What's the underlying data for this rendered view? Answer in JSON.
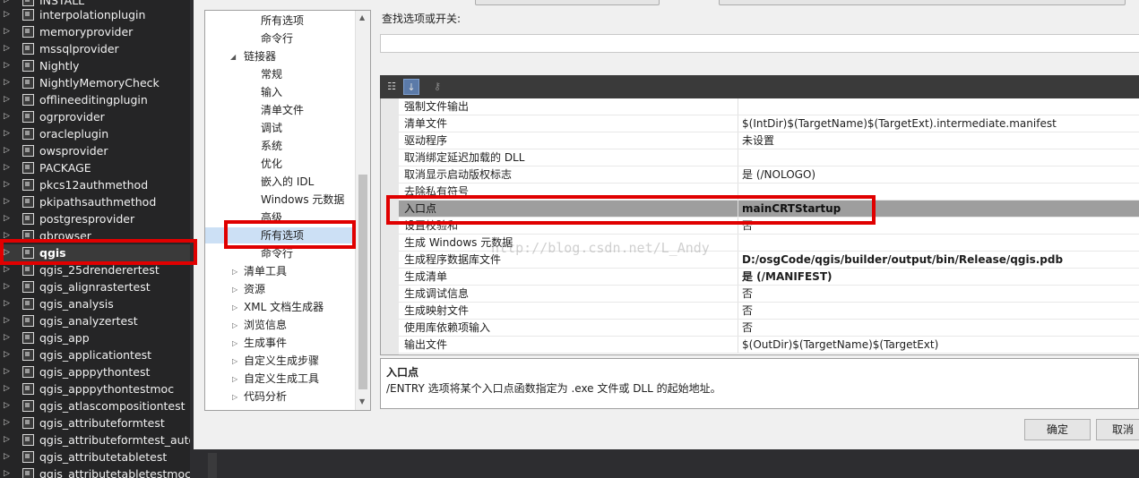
{
  "solution": {
    "projects": [
      {
        "label": "INSTALL"
      },
      {
        "label": "interpolationplugin"
      },
      {
        "label": "memoryprovider"
      },
      {
        "label": "mssqlprovider"
      },
      {
        "label": "Nightly"
      },
      {
        "label": "NightlyMemoryCheck"
      },
      {
        "label": "offlineeditingplugin"
      },
      {
        "label": "ogrprovider"
      },
      {
        "label": "oracleplugin"
      },
      {
        "label": "owsprovider"
      },
      {
        "label": "PACKAGE"
      },
      {
        "label": "pkcs12authmethod"
      },
      {
        "label": "pkipathsauthmethod"
      },
      {
        "label": "postgresprovider"
      },
      {
        "label": "qbrowser"
      },
      {
        "label": "qgis"
      },
      {
        "label": "qgis_25drenderertest"
      },
      {
        "label": "qgis_alignrastertest"
      },
      {
        "label": "qgis_analysis"
      },
      {
        "label": "qgis_analyzertest"
      },
      {
        "label": "qgis_app"
      },
      {
        "label": "qgis_applicationtest"
      },
      {
        "label": "qgis_apppythontest"
      },
      {
        "label": "qgis_apppythontestmoc"
      },
      {
        "label": "qgis_atlascompositiontest"
      },
      {
        "label": "qgis_attributeformtest"
      },
      {
        "label": "qgis_attributeformtest_autog"
      },
      {
        "label": "qgis_attributetabletest"
      },
      {
        "label": "qgis_attributetabletestmoc"
      }
    ]
  },
  "tree": {
    "nodes": [
      {
        "label": "所有选项"
      },
      {
        "label": "命令行"
      },
      {
        "label": "链接器"
      },
      {
        "label": "常规"
      },
      {
        "label": "输入"
      },
      {
        "label": "清单文件"
      },
      {
        "label": "调试"
      },
      {
        "label": "系统"
      },
      {
        "label": "优化"
      },
      {
        "label": "嵌入的 IDL"
      },
      {
        "label": "Windows 元数据"
      },
      {
        "label": "高级"
      },
      {
        "label": "所有选项"
      },
      {
        "label": "命令行"
      },
      {
        "label": "清单工具"
      },
      {
        "label": "资源"
      },
      {
        "label": "XML 文档生成器"
      },
      {
        "label": "浏览信息"
      },
      {
        "label": "生成事件"
      },
      {
        "label": "自定义生成步骤"
      },
      {
        "label": "自定义生成工具"
      },
      {
        "label": "代码分析"
      }
    ]
  },
  "search": {
    "label": "查找选项或开关:",
    "value": ""
  },
  "toolbar": {
    "categorized_icon": "categorized-icon",
    "alphabetical_icon": "alphabetical-icon",
    "property_pages_icon": "key-icon"
  },
  "grid": {
    "rows": [
      {
        "name": "强制文件输出",
        "value": ""
      },
      {
        "name": "清单文件",
        "value": "$(IntDir)$(TargetName)$(TargetExt).intermediate.manifest"
      },
      {
        "name": "驱动程序",
        "value": "未设置"
      },
      {
        "name": "取消绑定延迟加载的 DLL",
        "value": ""
      },
      {
        "name": "取消显示启动版权标志",
        "value": "是 (/NOLOGO)"
      },
      {
        "name": "去除私有符号",
        "value": ""
      },
      {
        "name": "入口点",
        "value": "mainCRTStartup"
      },
      {
        "name": "设置校验和",
        "value": "否"
      },
      {
        "name": "生成 Windows 元数据",
        "value": ""
      },
      {
        "name": "生成程序数据库文件",
        "value": "D:/osgCode/qgis/builder/output/bin/Release/qgis.pdb"
      },
      {
        "name": "生成清单",
        "value": "是 (/MANIFEST)"
      },
      {
        "name": "生成调试信息",
        "value": "否"
      },
      {
        "name": "生成映射文件",
        "value": "否"
      },
      {
        "name": "使用库依赖项输入",
        "value": "否"
      },
      {
        "name": "输出文件",
        "value": "$(OutDir)$(TargetName)$(TargetExt)"
      }
    ]
  },
  "description": {
    "title": "入口点",
    "text": "/ENTRY 选项将某个入口点函数指定为 .exe 文件或 DLL 的起始地址。"
  },
  "buttons": {
    "ok": "确定",
    "cancel": "取消"
  },
  "watermark": "http://blog.csdn.net/L_Andy",
  "colors": {
    "highlight_box": "#e00000",
    "selected_row": "#9e9e9e",
    "solution_bg": "#252526"
  }
}
